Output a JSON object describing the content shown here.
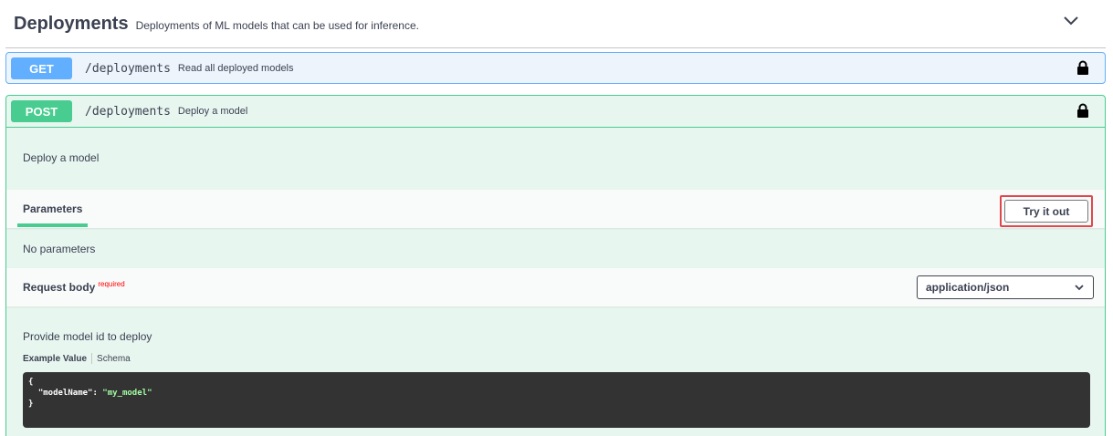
{
  "tag": {
    "title": "Deployments",
    "description": "Deployments of ML models that can be used for inference."
  },
  "operations": {
    "get": {
      "method": "GET",
      "path": "/deployments",
      "summary": "Read all deployed models"
    },
    "post": {
      "method": "POST",
      "path": "/deployments",
      "summary": "Deploy a model",
      "description": "Deploy a model",
      "parameters_label": "Parameters",
      "try_it_out_label": "Try it out",
      "no_parameters_text": "No parameters",
      "request_body_label": "Request body",
      "required_label": "required",
      "content_type_selected": "application/json",
      "body_description": "Provide model id to deploy",
      "example_tab_label": "Example Value",
      "schema_tab_label": "Schema",
      "example_code": {
        "open_brace": "{",
        "key": "\"modelName\"",
        "colon": ": ",
        "value": "\"my_model\"",
        "close_brace": "}"
      }
    }
  },
  "colors": {
    "get_accent": "#61affe",
    "post_accent": "#49cc90",
    "highlight_red": "#e0474c",
    "code_bg": "#333333",
    "code_string": "#a2fca2"
  },
  "icons": {
    "tag_toggle": "chevron-down-icon",
    "auth": "lock-icon",
    "select": "chevron-down-icon"
  }
}
